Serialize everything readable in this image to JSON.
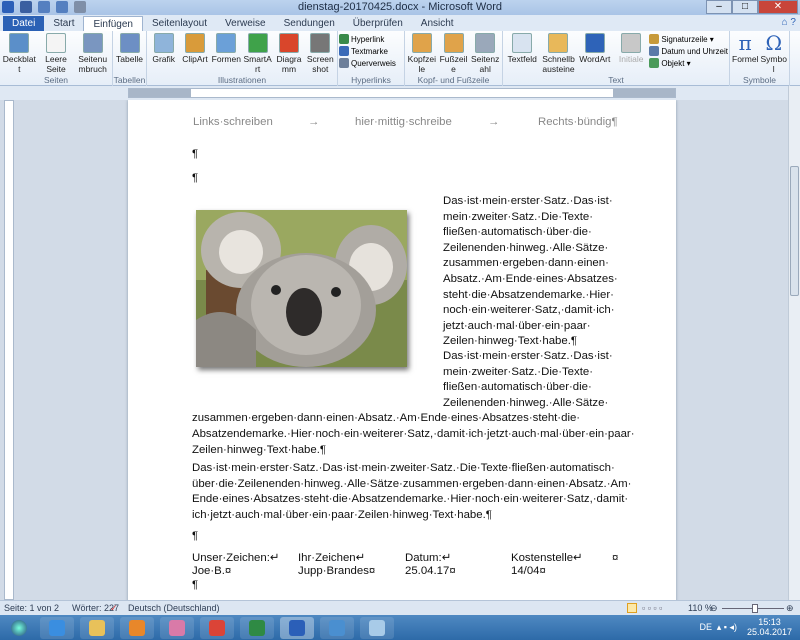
{
  "window": {
    "title": "dienstag-20170425.docx - Microsoft Word",
    "minimize": "–",
    "maximize": "□",
    "close": "✕"
  },
  "tabs": [
    {
      "label": "Datei"
    },
    {
      "label": "Start"
    },
    {
      "label": "Einfügen",
      "active": true
    },
    {
      "label": "Seitenlayout"
    },
    {
      "label": "Verweise"
    },
    {
      "label": "Sendungen"
    },
    {
      "label": "Überprüfen"
    },
    {
      "label": "Ansicht"
    }
  ],
  "ribbon": {
    "groups": [
      {
        "label": "Seiten",
        "buttons": [
          {
            "label": "Deckblatt",
            "icon": "cover-page-icon",
            "color": "#5b8fc9"
          },
          {
            "label": "Leere Seite",
            "icon": "blank-page-icon",
            "color": "#f4f4f4"
          },
          {
            "label": "Seitenumbruch",
            "icon": "page-break-icon",
            "color": "#7a96c0"
          }
        ]
      },
      {
        "label": "Tabellen",
        "buttons": [
          {
            "label": "Tabelle",
            "icon": "table-icon",
            "color": "#6d8fc4"
          }
        ]
      },
      {
        "label": "Illustrationen",
        "buttons": [
          {
            "label": "Grafik",
            "icon": "picture-icon",
            "color": "#8fb4da"
          },
          {
            "label": "ClipArt",
            "icon": "clipart-icon",
            "color": "#d99b3a"
          },
          {
            "label": "Formen",
            "icon": "shapes-icon",
            "color": "#6ba0d8"
          },
          {
            "label": "SmartArt",
            "icon": "smartart-icon",
            "color": "#3fa24a"
          },
          {
            "label": "Diagramm",
            "icon": "chart-icon",
            "color": "#d9462b"
          },
          {
            "label": "Screenshot",
            "icon": "screenshot-icon",
            "color": "#777777"
          }
        ]
      },
      {
        "label": "Hyperlinks",
        "small": [
          {
            "label": "Hyperlink",
            "icon": "hyperlink-icon",
            "color": "#3a8a4a"
          },
          {
            "label": "Textmarke",
            "icon": "bookmark-icon",
            "color": "#3a6ab8"
          },
          {
            "label": "Querverweis",
            "icon": "cross-reference-icon",
            "color": "#6d7f9a"
          }
        ]
      },
      {
        "label": "Kopf- und Fußzeile",
        "buttons": [
          {
            "label": "Kopfzeile",
            "icon": "header-icon",
            "color": "#e0a34a"
          },
          {
            "label": "Fußzeile",
            "icon": "footer-icon",
            "color": "#e0a34a"
          },
          {
            "label": "Seitenzahl",
            "icon": "page-number-icon",
            "color": "#9aa8ba"
          }
        ]
      },
      {
        "label": "Text",
        "buttons": [
          {
            "label": "Textfeld",
            "icon": "textbox-icon",
            "color": "#d8e3f0"
          },
          {
            "label": "Schnellbausteine",
            "icon": "quick-parts-icon",
            "color": "#e8b85a"
          },
          {
            "label": "WordArt",
            "icon": "wordart-icon",
            "color": "#2e63b8"
          },
          {
            "label": "Initiale",
            "icon": "drop-cap-icon",
            "color": "#c8c8c8",
            "disabled": true
          }
        ],
        "small": [
          {
            "label": "Signaturzeile ▾",
            "icon": "signature-line-icon",
            "color": "#c79a3a"
          },
          {
            "label": "Datum und Uhrzeit",
            "icon": "date-time-icon",
            "color": "#5a7aa8"
          },
          {
            "label": "Objekt ▾",
            "icon": "object-icon",
            "color": "#4a9a5a"
          }
        ]
      },
      {
        "label": "Symbole",
        "buttons": [
          {
            "label": "Formel",
            "icon": "equation-icon",
            "glyph": "π",
            "color": "#2e63b8"
          },
          {
            "label": "Symbol",
            "icon": "symbol-icon",
            "glyph": "Ω",
            "color": "#2e63b8"
          }
        ]
      }
    ]
  },
  "document": {
    "header": {
      "left": "Links·schreiben",
      "tab1": "→",
      "center": "hier·mittig·schreibe",
      "tab2": "→",
      "right": "Rechts·bündig¶"
    },
    "empty1": "¶",
    "empty2": "¶",
    "para1": [
      "Das·ist·mein·erster·Satz.·Das·ist·",
      "mein·zweiter·Satz.·Die·Texte·",
      "fließen·automatisch·über·die·",
      "Zeilenenden·hinweg.·Alle·Sätze·",
      "zusammen·ergeben·dann·einen·",
      "Absatz.·Am·Ende·eines·Absatzes·",
      "steht·die·Absatzendemarke.·Hier·",
      "noch·ein·weiterer·Satz,·damit·ich·",
      "jetzt·auch·mal·über·ein·paar·",
      "Zeilen·hinweg·Text·habe.¶"
    ],
    "para2": [
      "Das·ist·mein·erster·Satz.·Das·ist·",
      "mein·zweiter·Satz.·Die·Texte·",
      "fließen·automatisch·über·die·",
      "Zeilenenden·hinweg.·Alle·Sätze·",
      "zusammen·ergeben·dann·einen·Absatz.·Am·Ende·eines·Absatzes·steht·die·",
      "Absatzendemarke.·Hier·noch·ein·weiterer·Satz,·damit·ich·jetzt·auch·mal·über·ein·paar·",
      "Zeilen·hinweg·Text·habe.¶"
    ],
    "para3": [
      "Das·ist·mein·erster·Satz.·Das·ist·mein·zweiter·Satz.·Die·Texte·fließen·automatisch·",
      "über·die·Zeilenenden·hinweg.·Alle·Sätze·zusammen·ergeben·dann·einen·Absatz.·Am·",
      "Ende·eines·Absatzes·steht·die·Absatzendemarke.·Hier·noch·ein·weiterer·Satz,·damit·",
      "ich·jetzt·auch·mal·über·ein·paar·Zeilen·hinweg·Text·habe.¶"
    ],
    "empty3": "¶",
    "table": {
      "headers": [
        "Unser·Zeichen:↵",
        "Ihr·Zeichen↵",
        "Datum:↵",
        "Kostenstelle↵",
        "¤"
      ],
      "values": [
        "Joe·B.¤",
        "Jupp·Brandes¤",
        "25.04.17¤",
        "14/04¤"
      ]
    },
    "empty4": "¶",
    "image": {
      "icon": "koala-photo"
    }
  },
  "statusbar": {
    "page": "Seite: 1 von 2",
    "words": "Wörter: 227",
    "language": "Deutsch (Deutschland)",
    "zoom": "110 %",
    "zoom_percent": 110
  },
  "taskbar": {
    "apps": [
      {
        "icon": "ie-icon",
        "color": "#3a8ee0"
      },
      {
        "icon": "explorer-icon",
        "color": "#e8c15a"
      },
      {
        "icon": "outlook-icon",
        "color": "#e8872a"
      },
      {
        "icon": "snipping-tool-icon",
        "color": "#d97aa8"
      },
      {
        "icon": "chrome-icon",
        "color": "#db4437"
      },
      {
        "icon": "excel-icon",
        "color": "#2f8a44"
      },
      {
        "icon": "word-icon",
        "color": "#2b5fb8",
        "active": true
      },
      {
        "icon": "network-icon",
        "color": "#4a8fd0"
      },
      {
        "icon": "notepad-icon",
        "color": "#a8cbe8"
      }
    ],
    "lang": "DE",
    "time": "15:13",
    "date": "25.04.2017"
  }
}
